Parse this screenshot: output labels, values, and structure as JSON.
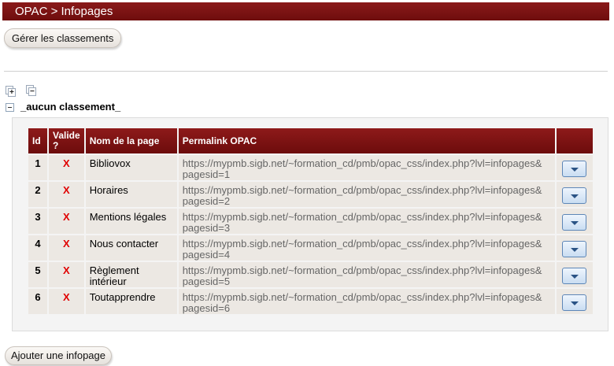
{
  "header": {
    "title": "OPAC > Infopages"
  },
  "toolbar": {
    "manage_label": "Gérer les classements"
  },
  "tree": {
    "expand_all_sign": "+",
    "collapse_all_sign": "−"
  },
  "group": {
    "label": "_aucun classement_"
  },
  "table": {
    "columns": {
      "id": "Id",
      "valid": "Valide ?",
      "name": "Nom de la page",
      "permalink": "Permalink OPAC"
    },
    "rows": [
      {
        "id": "1",
        "valid": "X",
        "name": "Bibliovox",
        "link": "https://mypmb.sigb.net/~formation_cd/pmb/opac_css/index.php?lvl=infopages& pagesid=1"
      },
      {
        "id": "2",
        "valid": "X",
        "name": "Horaires",
        "link": "https://mypmb.sigb.net/~formation_cd/pmb/opac_css/index.php?lvl=infopages& pagesid=2"
      },
      {
        "id": "3",
        "valid": "X",
        "name": "Mentions légales",
        "link": "https://mypmb.sigb.net/~formation_cd/pmb/opac_css/index.php?lvl=infopages& pagesid=3"
      },
      {
        "id": "4",
        "valid": "X",
        "name": "Nous contacter",
        "link": "https://mypmb.sigb.net/~formation_cd/pmb/opac_css/index.php?lvl=infopages& pagesid=4"
      },
      {
        "id": "5",
        "valid": "X",
        "name": "Règlement intérieur",
        "link": "https://mypmb.sigb.net/~formation_cd/pmb/opac_css/index.php?lvl=infopages& pagesid=5"
      },
      {
        "id": "6",
        "valid": "X",
        "name": "Toutapprendre",
        "link": "https://mypmb.sigb.net/~formation_cd/pmb/opac_css/index.php?lvl=infopages& pagesid=6"
      }
    ]
  },
  "footer": {
    "add_label": "Ajouter une infopage"
  },
  "colors": {
    "header_bg": "#7a1414",
    "invalid_mark": "#e00000",
    "row_bg": "#ece8e3"
  }
}
